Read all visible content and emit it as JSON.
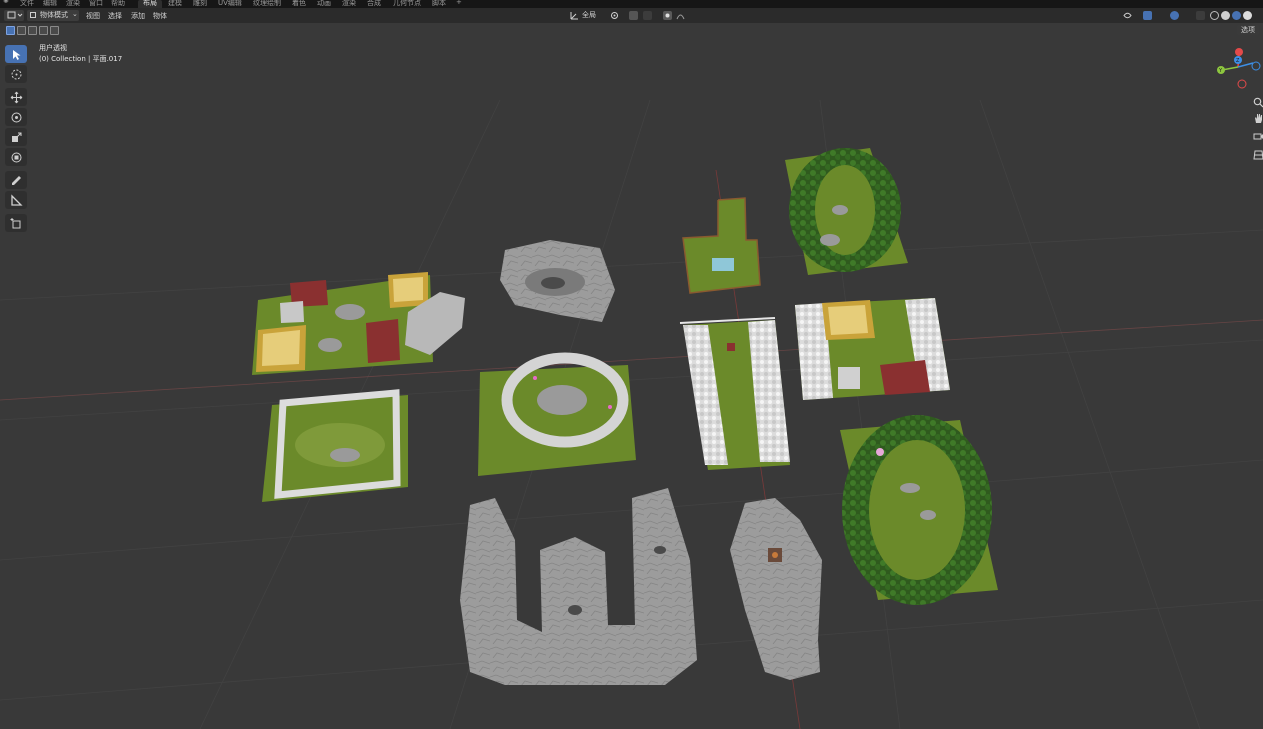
{
  "menubar": {
    "items": [
      "文件",
      "编辑",
      "渲染",
      "窗口",
      "帮助"
    ],
    "tabs": [
      "布局",
      "建模",
      "雕刻",
      "UV编辑",
      "纹理绘制",
      "着色",
      "动画",
      "渲染",
      "合成",
      "几何节点",
      "脚本"
    ],
    "active_tab": "布局",
    "add_tab_symbol": "+"
  },
  "header": {
    "editor_type_icon": "viewport-icon",
    "mode_label": "物体模式",
    "menus": [
      "视图",
      "选择",
      "添加",
      "物体"
    ],
    "transform_orientation": "全局",
    "options_label": "选项"
  },
  "overlay": {
    "view_name": "用户透视",
    "collection_info": "(0) Collection | 平面.017"
  },
  "gizmo": {
    "axes": [
      "X",
      "Y",
      "Z"
    ],
    "colors": {
      "x": "#e34a4a",
      "y": "#8dc63f",
      "z": "#3d8fe6"
    }
  },
  "toolbar": {
    "tools": [
      "select-box",
      "cursor",
      "move",
      "rotate",
      "scale",
      "transform",
      "annotate",
      "measure",
      "add-cube"
    ],
    "active": "select-box"
  },
  "colors": {
    "accent": "#4772b3",
    "viewport_bg": "#393939",
    "grass": "#6b8a2a",
    "rock": "#9a9a9a",
    "roof_red": "#8a3030",
    "roof_gold": "#c9a33a"
  }
}
